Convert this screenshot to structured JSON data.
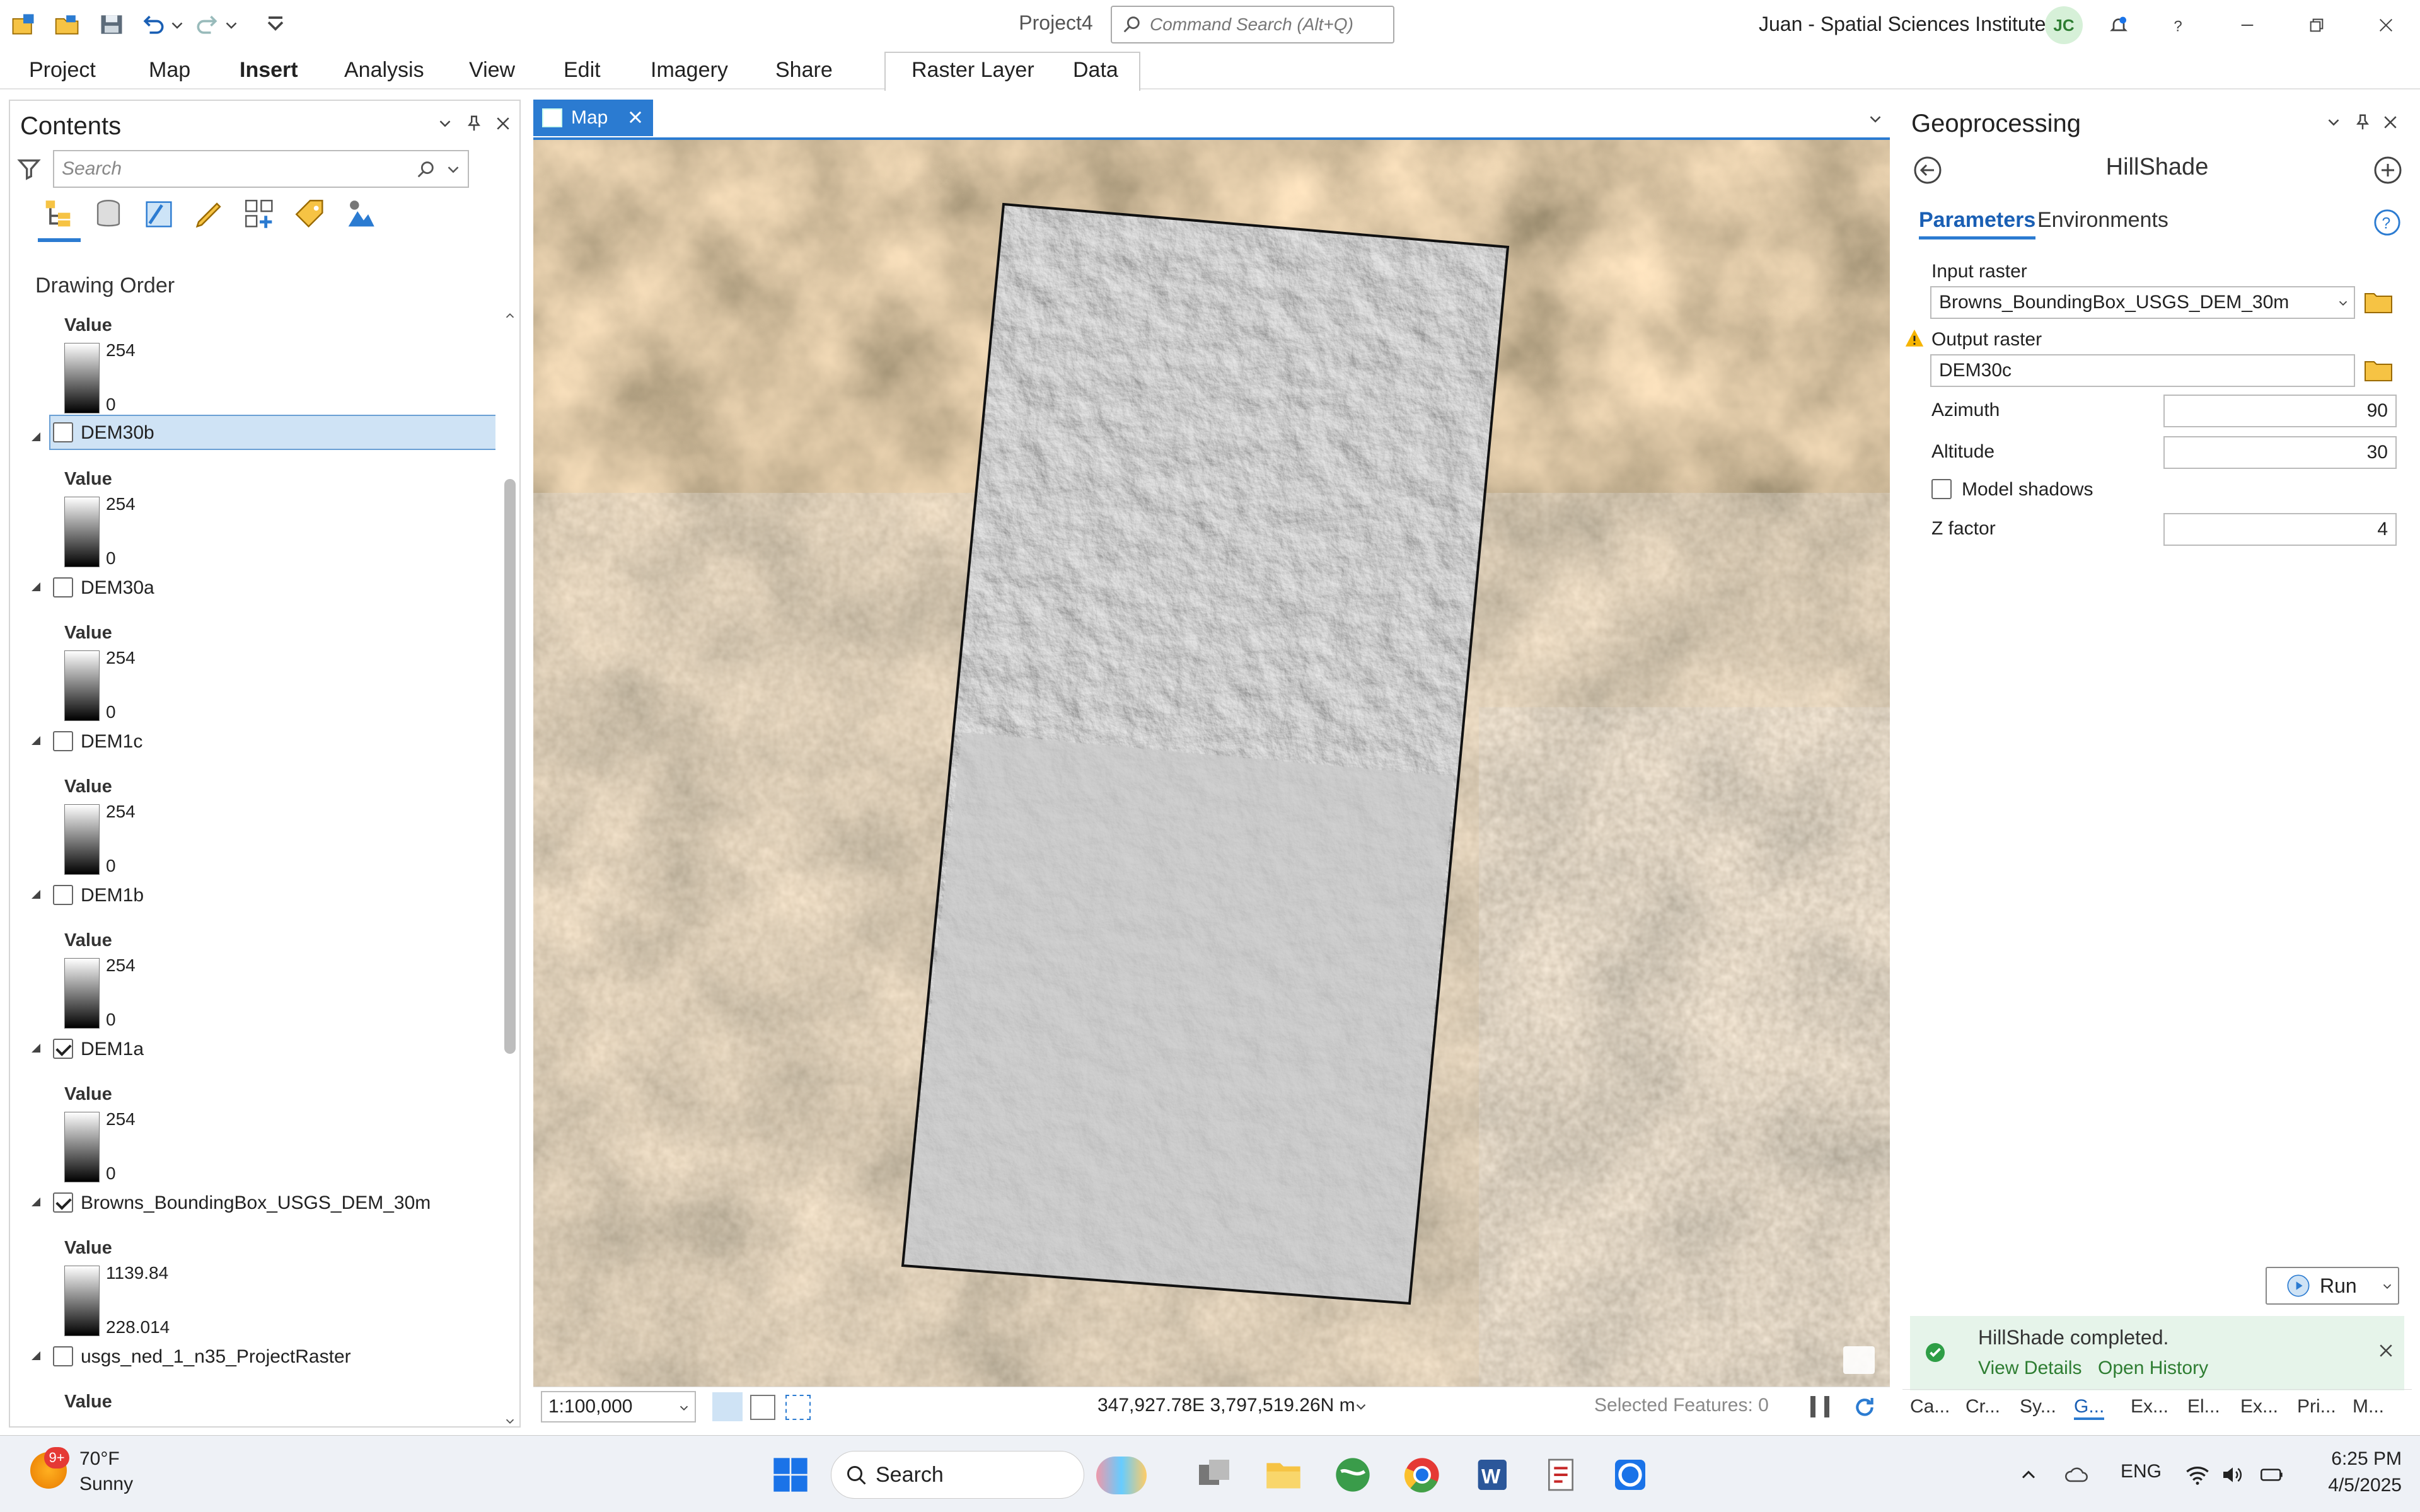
{
  "window": {
    "project_name": "Project4",
    "command_search_placeholder": "Command Search (Alt+Q)",
    "user_name": "Juan - Spatial Sciences Institute",
    "user_initials": "JC"
  },
  "ribbon": {
    "tabs": [
      "Project",
      "Map",
      "Insert",
      "Analysis",
      "View",
      "Edit",
      "Imagery",
      "Share"
    ],
    "active_tab": "Insert",
    "contextual_tabs": [
      "Raster Layer",
      "Data"
    ]
  },
  "contents": {
    "title": "Contents",
    "search_placeholder": "Search",
    "drawing_order_label": "Drawing Order",
    "value_label": "Value",
    "layers": [
      {
        "name": "",
        "checked": false,
        "max": "254",
        "min": "0"
      },
      {
        "name": "DEM30b",
        "checked": false,
        "max": "254",
        "min": "0",
        "selected": true
      },
      {
        "name": "DEM30a",
        "checked": false,
        "max": "254",
        "min": "0"
      },
      {
        "name": "DEM1c",
        "checked": false,
        "max": "254",
        "min": "0"
      },
      {
        "name": "DEM1b",
        "checked": false,
        "max": "254",
        "min": "0"
      },
      {
        "name": "DEM1a",
        "checked": true,
        "max": "254",
        "min": "0"
      },
      {
        "name": "Browns_BoundingBox_USGS_DEM_30m",
        "checked": true,
        "max": "1139.84",
        "min": "228.014"
      },
      {
        "name": "usgs_ned_1_n35_ProjectRaster",
        "checked": false,
        "max": "",
        "min": ""
      }
    ]
  },
  "map": {
    "tab_label": "Map",
    "scale": "1:100,000",
    "coordinates": "347,927.78E 3,797,519.26N m",
    "selected_features": "Selected Features: 0"
  },
  "geoprocessing": {
    "title": "Geoprocessing",
    "tool_name": "HillShade",
    "tabs": {
      "parameters": "Parameters",
      "environments": "Environments"
    },
    "input_raster_label": "Input raster",
    "input_raster_value": "Browns_BoundingBox_USGS_DEM_30m",
    "output_raster_label": "Output raster",
    "output_raster_value": "DEM30c",
    "azimuth_label": "Azimuth",
    "azimuth_value": "90",
    "altitude_label": "Altitude",
    "altitude_value": "30",
    "model_shadows_label": "Model shadows",
    "z_factor_label": "Z factor",
    "z_factor_value": "4",
    "run_label": "Run",
    "message": "HillShade completed.",
    "view_details": "View Details",
    "open_history": "Open History",
    "bottom_tabs": [
      "Ca...",
      "Cr...",
      "Sy...",
      "G...",
      "Ex...",
      "El...",
      "Ex...",
      "Pri...",
      "M..."
    ]
  },
  "taskbar": {
    "weather_badge": "9+",
    "temperature": "70°F",
    "condition": "Sunny",
    "search_label": "Search",
    "language": "ENG",
    "time": "6:25 PM",
    "date": "4/5/2025"
  }
}
